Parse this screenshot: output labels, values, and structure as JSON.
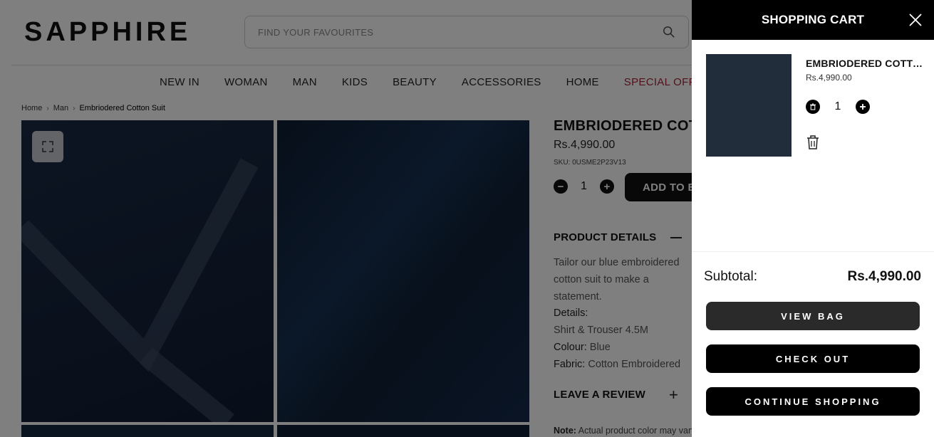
{
  "header": {
    "logo": "SAPPHIRE",
    "search_placeholder": "FIND YOUR FAVOURITES"
  },
  "nav": [
    "NEW IN",
    "WOMAN",
    "MAN",
    "KIDS",
    "BEAUTY",
    "ACCESSORIES",
    "HOME",
    "SPECIAL OFFER"
  ],
  "breadcrumb": [
    "Home",
    "Man",
    "Embriodered Cotton Suit"
  ],
  "product": {
    "title": "EMBRIODERED COTTON SUIT",
    "price": "Rs.4,990.00",
    "sku": "SKU: 0USME2P23V13",
    "quantity": "1",
    "add_to_bag": "ADD TO BAG",
    "details_heading": "PRODUCT DETAILS",
    "description": "Tailor our blue embroidered cotton suit to make a statement.",
    "details_label": "Details:",
    "details_value": "Shirt & Trouser 4.5M",
    "colour_label": "Colour:",
    "colour_value": "Blue",
    "fabric_label": "Fabric:",
    "fabric_value": "Cotton Embroidered",
    "review_heading": "LEAVE A REVIEW",
    "note_label": "Note:",
    "note_text": "Actual product color may vary"
  },
  "cart": {
    "title": "SHOPPING CART",
    "item": {
      "name": "EMBRIODERED COTTON SUIT",
      "price": "Rs.4,990.00",
      "quantity": "1"
    },
    "subtotal_label": "Subtotal:",
    "subtotal_value": "Rs.4,990.00",
    "view_bag": "VIEW BAG",
    "check_out": "CHECK OUT",
    "continue_shopping": "CONTINUE SHOPPING"
  },
  "colors": {
    "special_offer": "#a3243b",
    "cart_header": "#000000",
    "product_swatch": "#222d3b"
  }
}
